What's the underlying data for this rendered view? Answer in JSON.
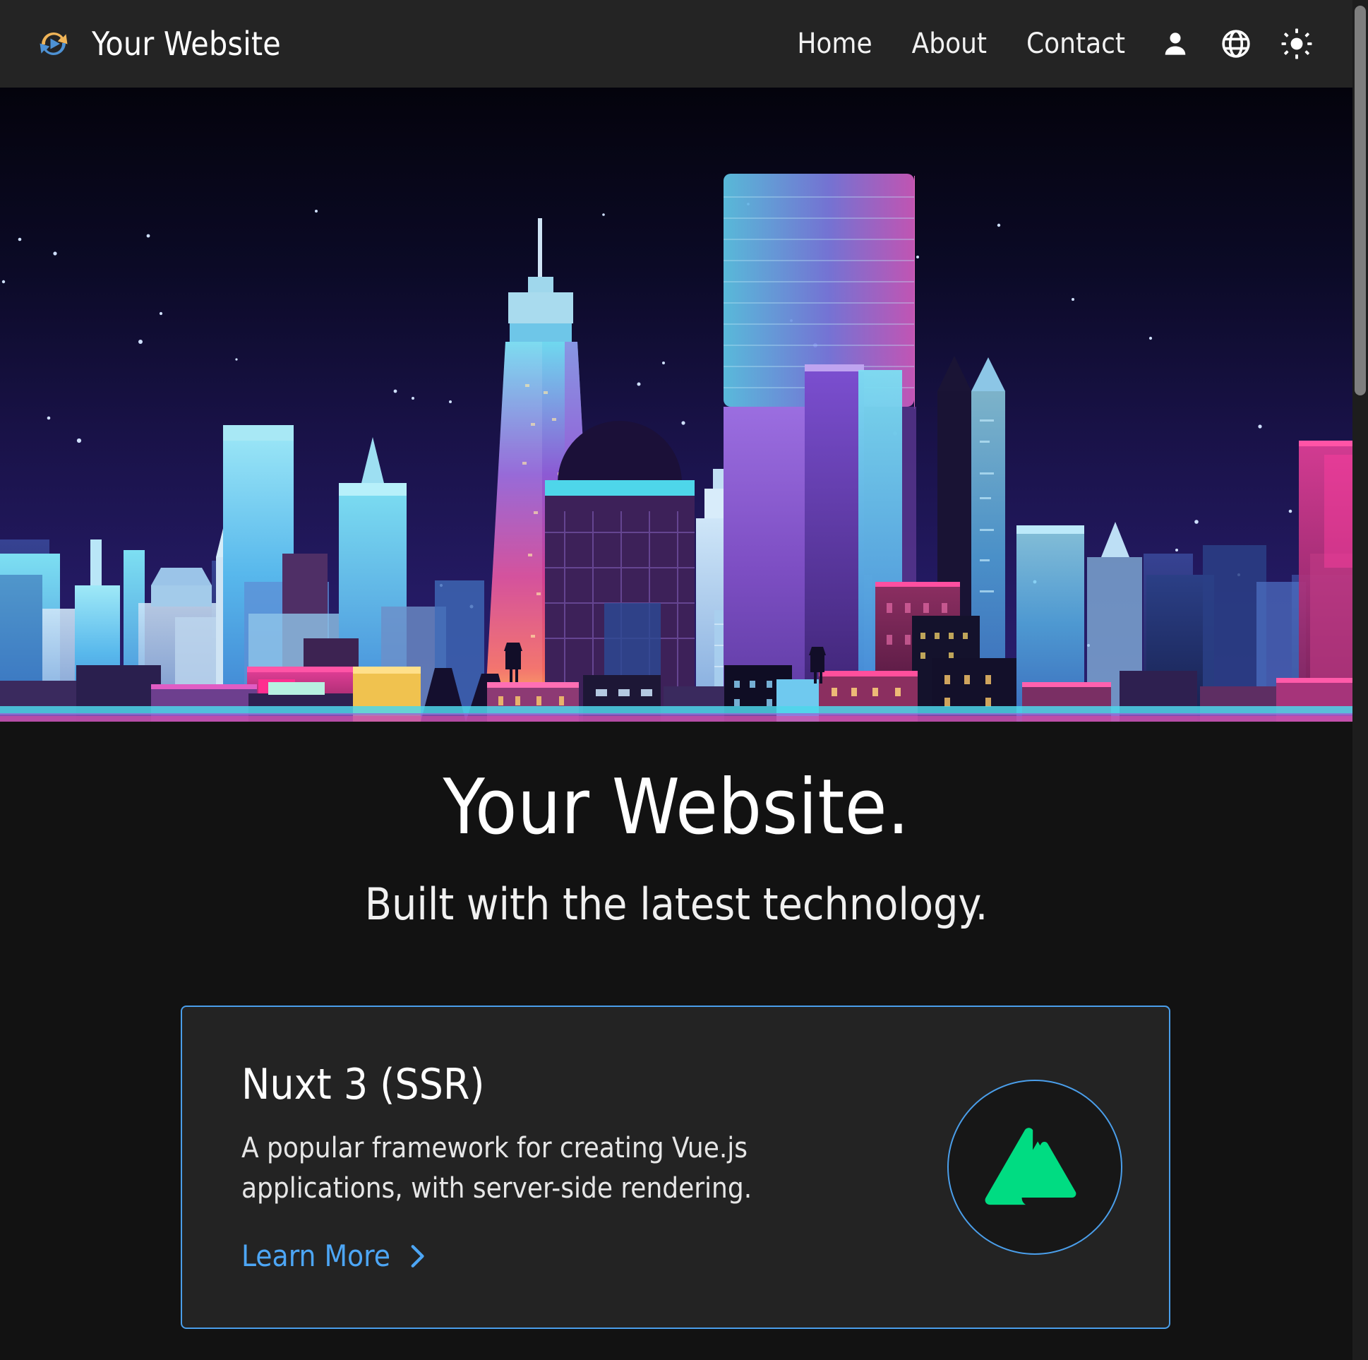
{
  "header": {
    "brand_name": "Your Website",
    "logo_icon": "sync-play-logo-icon",
    "logo_colors": {
      "top_arc": "#efb458",
      "bottom_arc": "#4e92d4",
      "play": "#4e92d4"
    },
    "nav_links": [
      {
        "label": "Home",
        "name": "nav-link-home"
      },
      {
        "label": "About",
        "name": "nav-link-about"
      },
      {
        "label": "Contact",
        "name": "nav-link-contact"
      }
    ],
    "icon_buttons": [
      {
        "icon": "user-account-icon",
        "name": "account-button"
      },
      {
        "icon": "globe-language-icon",
        "name": "language-button"
      },
      {
        "icon": "sun-theme-icon",
        "name": "theme-toggle-button"
      }
    ],
    "background_color": "#242424"
  },
  "hero": {
    "image_alt": "Neon night city skyline illustration",
    "sky_top_color": "#05040f",
    "sky_bottom_color": "#2a1a63",
    "accent_colors": [
      "#3fe0e8",
      "#ff3ea5",
      "#7b5cf0",
      "#5bb8ff"
    ]
  },
  "main": {
    "heading": "Your Website.",
    "subheading": "Built with the latest technology.",
    "background_color": "#121212"
  },
  "card": {
    "title": "Nuxt 3 (SSR)",
    "description": "A popular framework for creating Vue.js applications, with server-side rendering.",
    "link_label": "Learn More",
    "link_icon": "chevron-right-icon",
    "link_color": "#4da6f5",
    "border_color": "#4a9eea",
    "background_color": "#232323",
    "logo_icon": "nuxt-mountain-icon",
    "logo_color": "#00dc82"
  },
  "scrollbar": {
    "name": "vertical-scrollbar",
    "thumb_color": "#7e7e7e",
    "track_color": "#1d1d1d"
  }
}
